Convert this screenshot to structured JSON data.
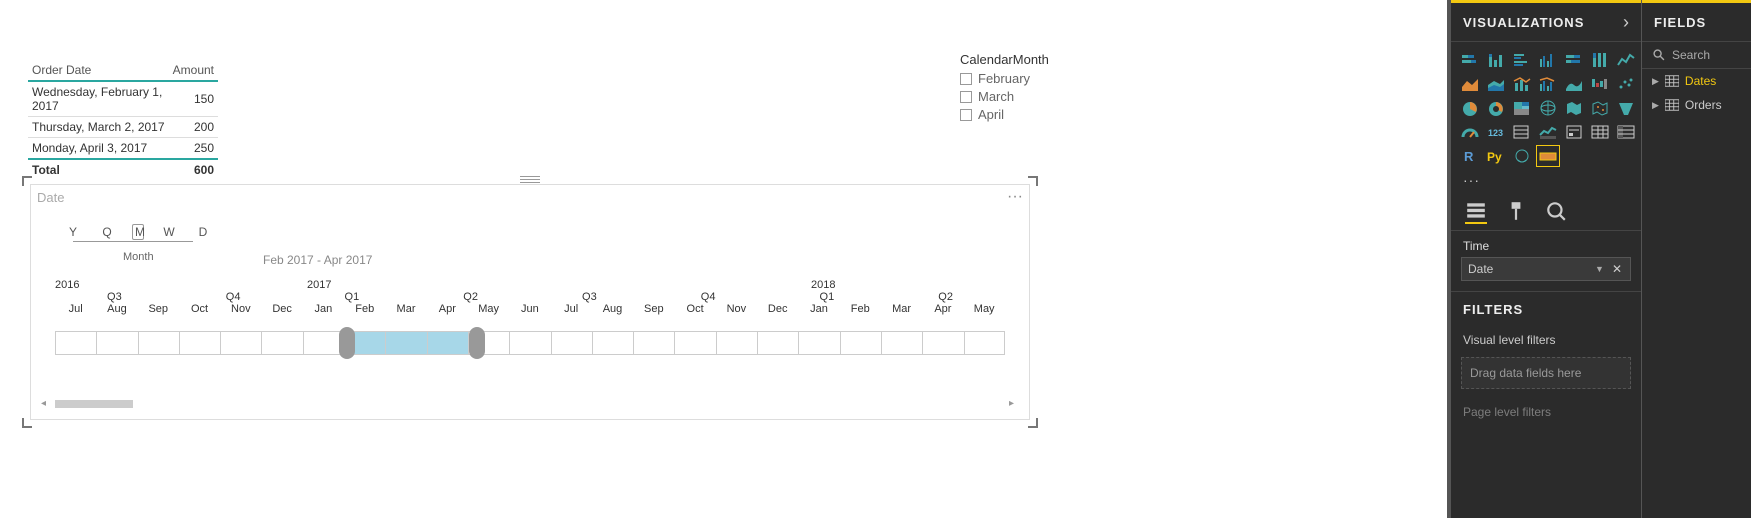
{
  "table": {
    "headers": {
      "date": "Order Date",
      "amount": "Amount"
    },
    "rows": [
      {
        "date": "Wednesday, February 1, 2017",
        "amount": "150"
      },
      {
        "date": "Thursday, March 2, 2017",
        "amount": "200"
      },
      {
        "date": "Monday, April 3, 2017",
        "amount": "250"
      }
    ],
    "total_label": "Total",
    "total_value": "600"
  },
  "slicer": {
    "title": "CalendarMonth",
    "options": [
      "February",
      "March",
      "April"
    ]
  },
  "timeline": {
    "title": "Date",
    "granularity": {
      "items": [
        "Y",
        "Q",
        "M",
        "W",
        "D"
      ],
      "selected": "M",
      "sub": "Month"
    },
    "range_label": "Feb 2017 - Apr 2017",
    "years": [
      "2016",
      "2017",
      "2018"
    ],
    "quarters": [
      "Q3",
      "Q4",
      "Q1",
      "Q2",
      "Q3",
      "Q4",
      "Q1",
      "Q2"
    ],
    "months": [
      "Jul",
      "Aug",
      "Sep",
      "Oct",
      "Nov",
      "Dec",
      "Jan",
      "Feb",
      "Mar",
      "Apr",
      "May",
      "Jun",
      "Jul",
      "Aug",
      "Sep",
      "Oct",
      "Nov",
      "Dec",
      "Jan",
      "Feb",
      "Mar",
      "Apr",
      "May"
    ],
    "selected_months": [
      "Feb",
      "Mar",
      "Apr"
    ],
    "selected_start_index": 7,
    "selected_end_index": 9
  },
  "viz_pane": {
    "title": "VISUALIZATIONS",
    "well": {
      "label": "Time",
      "field": "Date"
    },
    "filters_title": "FILTERS",
    "filters_sub": "Visual level filters",
    "filters_drop": "Drag data fields here",
    "page_filters": "Page level filters"
  },
  "fields_pane": {
    "title": "FIELDS",
    "search_placeholder": "Search",
    "tables": [
      {
        "name": "Dates",
        "selected": true
      },
      {
        "name": "Orders",
        "selected": false
      }
    ]
  },
  "colors": {
    "accent": "#f2c811",
    "sel_fill": "#a7d7e8"
  }
}
